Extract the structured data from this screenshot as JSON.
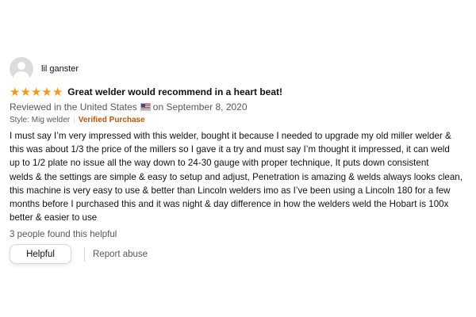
{
  "review": {
    "profile_name": "lil ganster",
    "rating": 5,
    "title": "Great welder would recommend in a heart beat!",
    "reviewed_prefix": "Reviewed in the United States",
    "reviewed_suffix": "on September 8, 2020",
    "style": "Style: Mig welder",
    "verified_label": "Verified Purchase",
    "body": "I must say I’m very impressed with this welder, bought it because I needed to upgrade my old miller welder &\nthis was about 1/3 the price of the millers so I gave it a try and must say I’m thought it impressed, it can weld\nup to 1/2 plate no issue all the way down to 24-30 gauge with proper technique, It puts down consistent\nwelds & the settings are simple & easy to setup and adjust, Penetration is amazing & welds always looks clean,\nthis machine is very easy to use & better than Lincoln welders imo as I’ve been using a Lincoln 180 for a few\nmonths before I purchased this and it was night & day difference in how the welders weld the Hobart is 100x\nbetter & easier to use",
    "helpful_count_text": "3 people found this helpful",
    "helpful_button_label": "Helpful",
    "report_label": "Report abuse",
    "star_color": "#f39b18",
    "verified_color": "#c45500"
  }
}
